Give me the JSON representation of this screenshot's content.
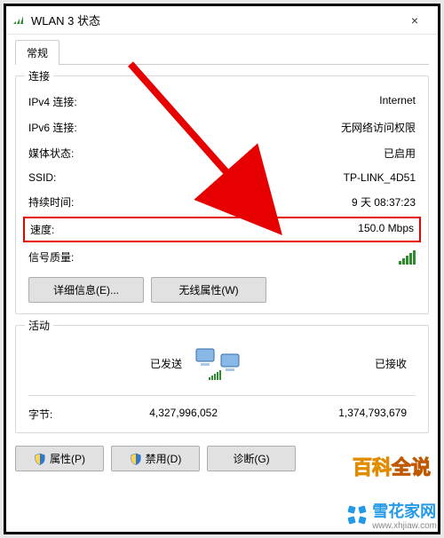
{
  "titlebar": {
    "icon_name": "wifi-icon",
    "title": "WLAN 3 状态",
    "close": "×"
  },
  "tab_general": "常规",
  "connection": {
    "title": "连接",
    "ipv4_label": "IPv4 连接:",
    "ipv4_value": "Internet",
    "ipv6_label": "IPv6 连接:",
    "ipv6_value": "无网络访问权限",
    "media_label": "媒体状态:",
    "media_value": "已启用",
    "ssid_label": "SSID:",
    "ssid_value": "TP-LINK_4D51",
    "duration_label": "持续时间:",
    "duration_value": "9 天 08:37:23",
    "speed_label": "速度:",
    "speed_value": "150.0 Mbps",
    "signal_label": "信号质量:",
    "details_btn": "详细信息(E)...",
    "wireless_btn": "无线属性(W)"
  },
  "activity": {
    "title": "活动",
    "sent_label": "已发送",
    "received_label": "已接收",
    "bytes_label": "字节:",
    "bytes_sent": "4,327,996,052",
    "bytes_received": "1,374,793,679"
  },
  "buttons": {
    "properties": "属性(P)",
    "disable": "禁用(D)",
    "diagnose": "诊断(G)"
  },
  "overlay": {
    "encyclopedia": "百科全说"
  },
  "watermark": {
    "text": "雪花家网",
    "url": "www.xhjiaw.com"
  }
}
